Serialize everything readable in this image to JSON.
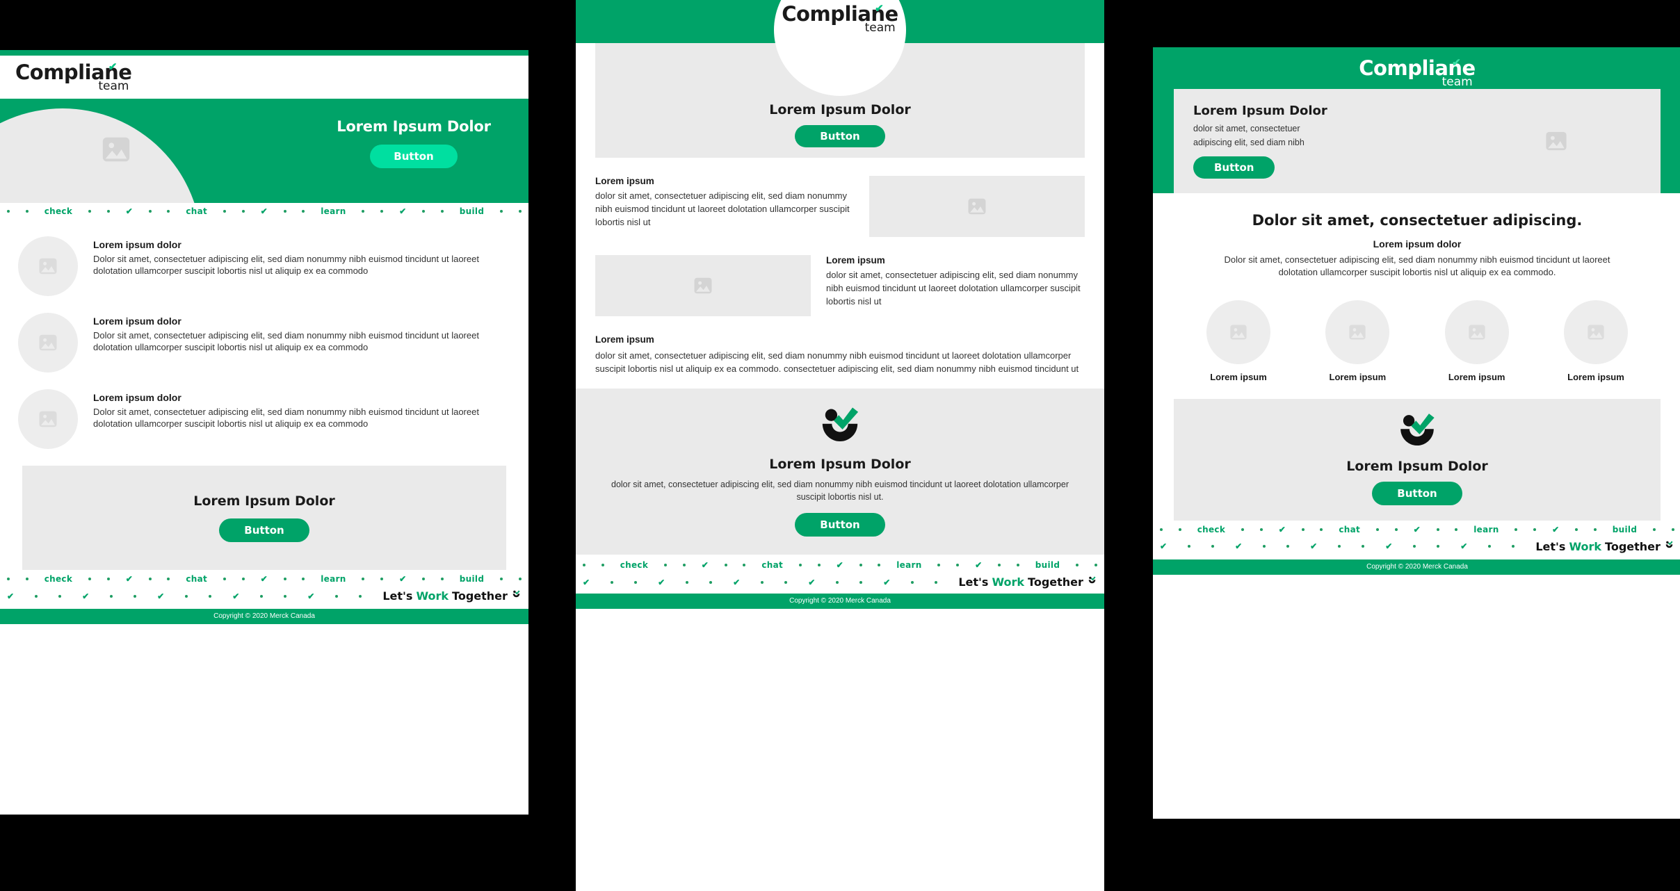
{
  "brand": {
    "logo_word": "Complian",
    "logo_word_tail": "e",
    "logo_sub": "team",
    "check_glyph": "✔",
    "colors": {
      "green": "#00A368",
      "mint": "#00DFA0",
      "light_gray": "#EAEAEA",
      "circle_gray": "#EDEDED",
      "text_dark": "#1a1a1a",
      "black": "#000000",
      "white": "#FFFFFF"
    }
  },
  "band": {
    "words": [
      "check",
      "chat",
      "learn",
      "build"
    ],
    "check_glyph": "✔",
    "tagline_lets": "Let's",
    "tagline_work": "Work",
    "tagline_together": "Together"
  },
  "footer": {
    "copyright": "Copyright © 2020 Merck Canada"
  },
  "panel_left": {
    "hero": {
      "title": "Lorem Ipsum Dolor",
      "button": "Button"
    },
    "items": [
      {
        "title": "Lorem ipsum dolor",
        "body": "Dolor sit amet, consectetuer adipiscing elit, sed diam nonummy nibh euismod tincidunt ut laoreet dolotation ullamcorper suscipit lobortis nisl ut aliquip ex ea commodo"
      },
      {
        "title": "Lorem ipsum dolor",
        "body": "Dolor sit amet, consectetuer adipiscing elit, sed diam nonummy nibh euismod tincidunt ut laoreet dolotation ullamcorper suscipit lobortis nisl ut aliquip ex ea commodo"
      },
      {
        "title": "Lorem ipsum dolor",
        "body": "Dolor sit amet, consectetuer adipiscing elit, sed diam nonummy nibh euismod tincidunt ut laoreet dolotation ullamcorper suscipit lobortis nisl ut aliquip ex ea commodo"
      }
    ],
    "cta": {
      "title": "Lorem Ipsum Dolor",
      "button": "Button"
    }
  },
  "panel_mid": {
    "hero": {
      "title": "Lorem Ipsum Dolor",
      "button": "Button"
    },
    "row1": {
      "title": "Lorem ipsum",
      "body": "dolor sit amet, consectetuer adipiscing elit, sed diam nonummy nibh euismod tincidunt ut laoreet dolotation ullamcorper suscipit lobortis nisl ut"
    },
    "row2": {
      "title": "Lorem ipsum",
      "body": "dolor sit amet, consectetuer adipiscing elit, sed diam nonummy nibh euismod tincidunt ut laoreet dolotation ullamcorper suscipit lobortis nisl ut"
    },
    "wide": {
      "title": "Lorem ipsum",
      "body": "dolor sit amet, consectetuer adipiscing elit, sed diam nonummy nibh euismod tincidunt ut laoreet dolotation ullamcorper suscipit lobortis nisl ut aliquip ex ea commodo. consectetuer adipiscing elit, sed diam nonummy nibh euismod tincidunt ut"
    },
    "cta": {
      "title": "Lorem Ipsum Dolor",
      "body": "dolor sit amet, consectetuer adipiscing elit, sed diam nonummy nibh euismod tincidunt ut laoreet dolotation ullamcorper suscipit lobortis nisl ut.",
      "button": "Button"
    }
  },
  "panel_right": {
    "hero": {
      "title": "Lorem Ipsum Dolor",
      "body_line1": "dolor sit amet, consectetuer",
      "body_line2": "adipiscing elit, sed diam nibh",
      "button": "Button"
    },
    "section": {
      "heading": "Dolor sit amet, consectetuer adipiscing.",
      "subheading": "Lorem ipsum dolor",
      "body": "Dolor sit amet, consectetuer adipiscing elit, sed diam nonummy nibh euismod tincidunt ut laoreet dolotation ullamcorper suscipit lobortis nisl ut aliquip ex ea commodo."
    },
    "icons": [
      {
        "label": "Lorem ipsum"
      },
      {
        "label": "Lorem ipsum"
      },
      {
        "label": "Lorem ipsum"
      },
      {
        "label": "Lorem ipsum"
      }
    ],
    "cta": {
      "title": "Lorem Ipsum Dolor",
      "button": "Button"
    }
  }
}
